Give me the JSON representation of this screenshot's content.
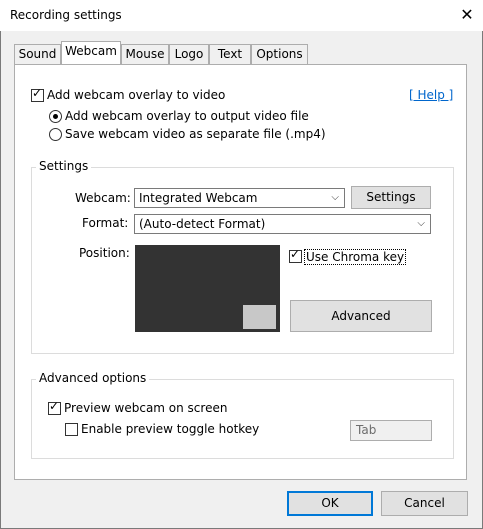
{
  "window": {
    "title": "Recording settings",
    "close_glyph": "✕"
  },
  "tabs": [
    {
      "label": "Sound",
      "active": false
    },
    {
      "label": "Webcam",
      "active": true
    },
    {
      "label": "Mouse",
      "active": false
    },
    {
      "label": "Logo",
      "active": false
    },
    {
      "label": "Text",
      "active": false
    },
    {
      "label": "Options",
      "active": false
    }
  ],
  "webcam_overlay": {
    "checkbox_label": "Add webcam overlay to video",
    "checked": true,
    "help_link": "[ Help ]",
    "radio_output": "Add webcam overlay to output video file",
    "radio_separate": "Save webcam video as separate file (.mp4)",
    "selected": "output"
  },
  "settings": {
    "group_label": "Settings",
    "webcam_label": "Webcam:",
    "webcam_value": "Integrated Webcam",
    "settings_button": "Settings",
    "format_label": "Format:",
    "format_value": "(Auto-detect Format)",
    "position_label": "Position:",
    "chroma_label": "Use Chroma key",
    "chroma_checked": true,
    "advanced_button": "Advanced"
  },
  "advanced_options": {
    "group_label": "Advanced options",
    "preview_label": "Preview webcam on screen",
    "preview_checked": true,
    "hotkey_label": "Enable preview toggle hotkey",
    "hotkey_checked": false,
    "hotkey_value": "Tab"
  },
  "footer": {
    "ok": "OK",
    "cancel": "Cancel"
  },
  "colors": {
    "accent": "#0078d7",
    "link": "#0066cc",
    "preview_bg": "#333333"
  }
}
